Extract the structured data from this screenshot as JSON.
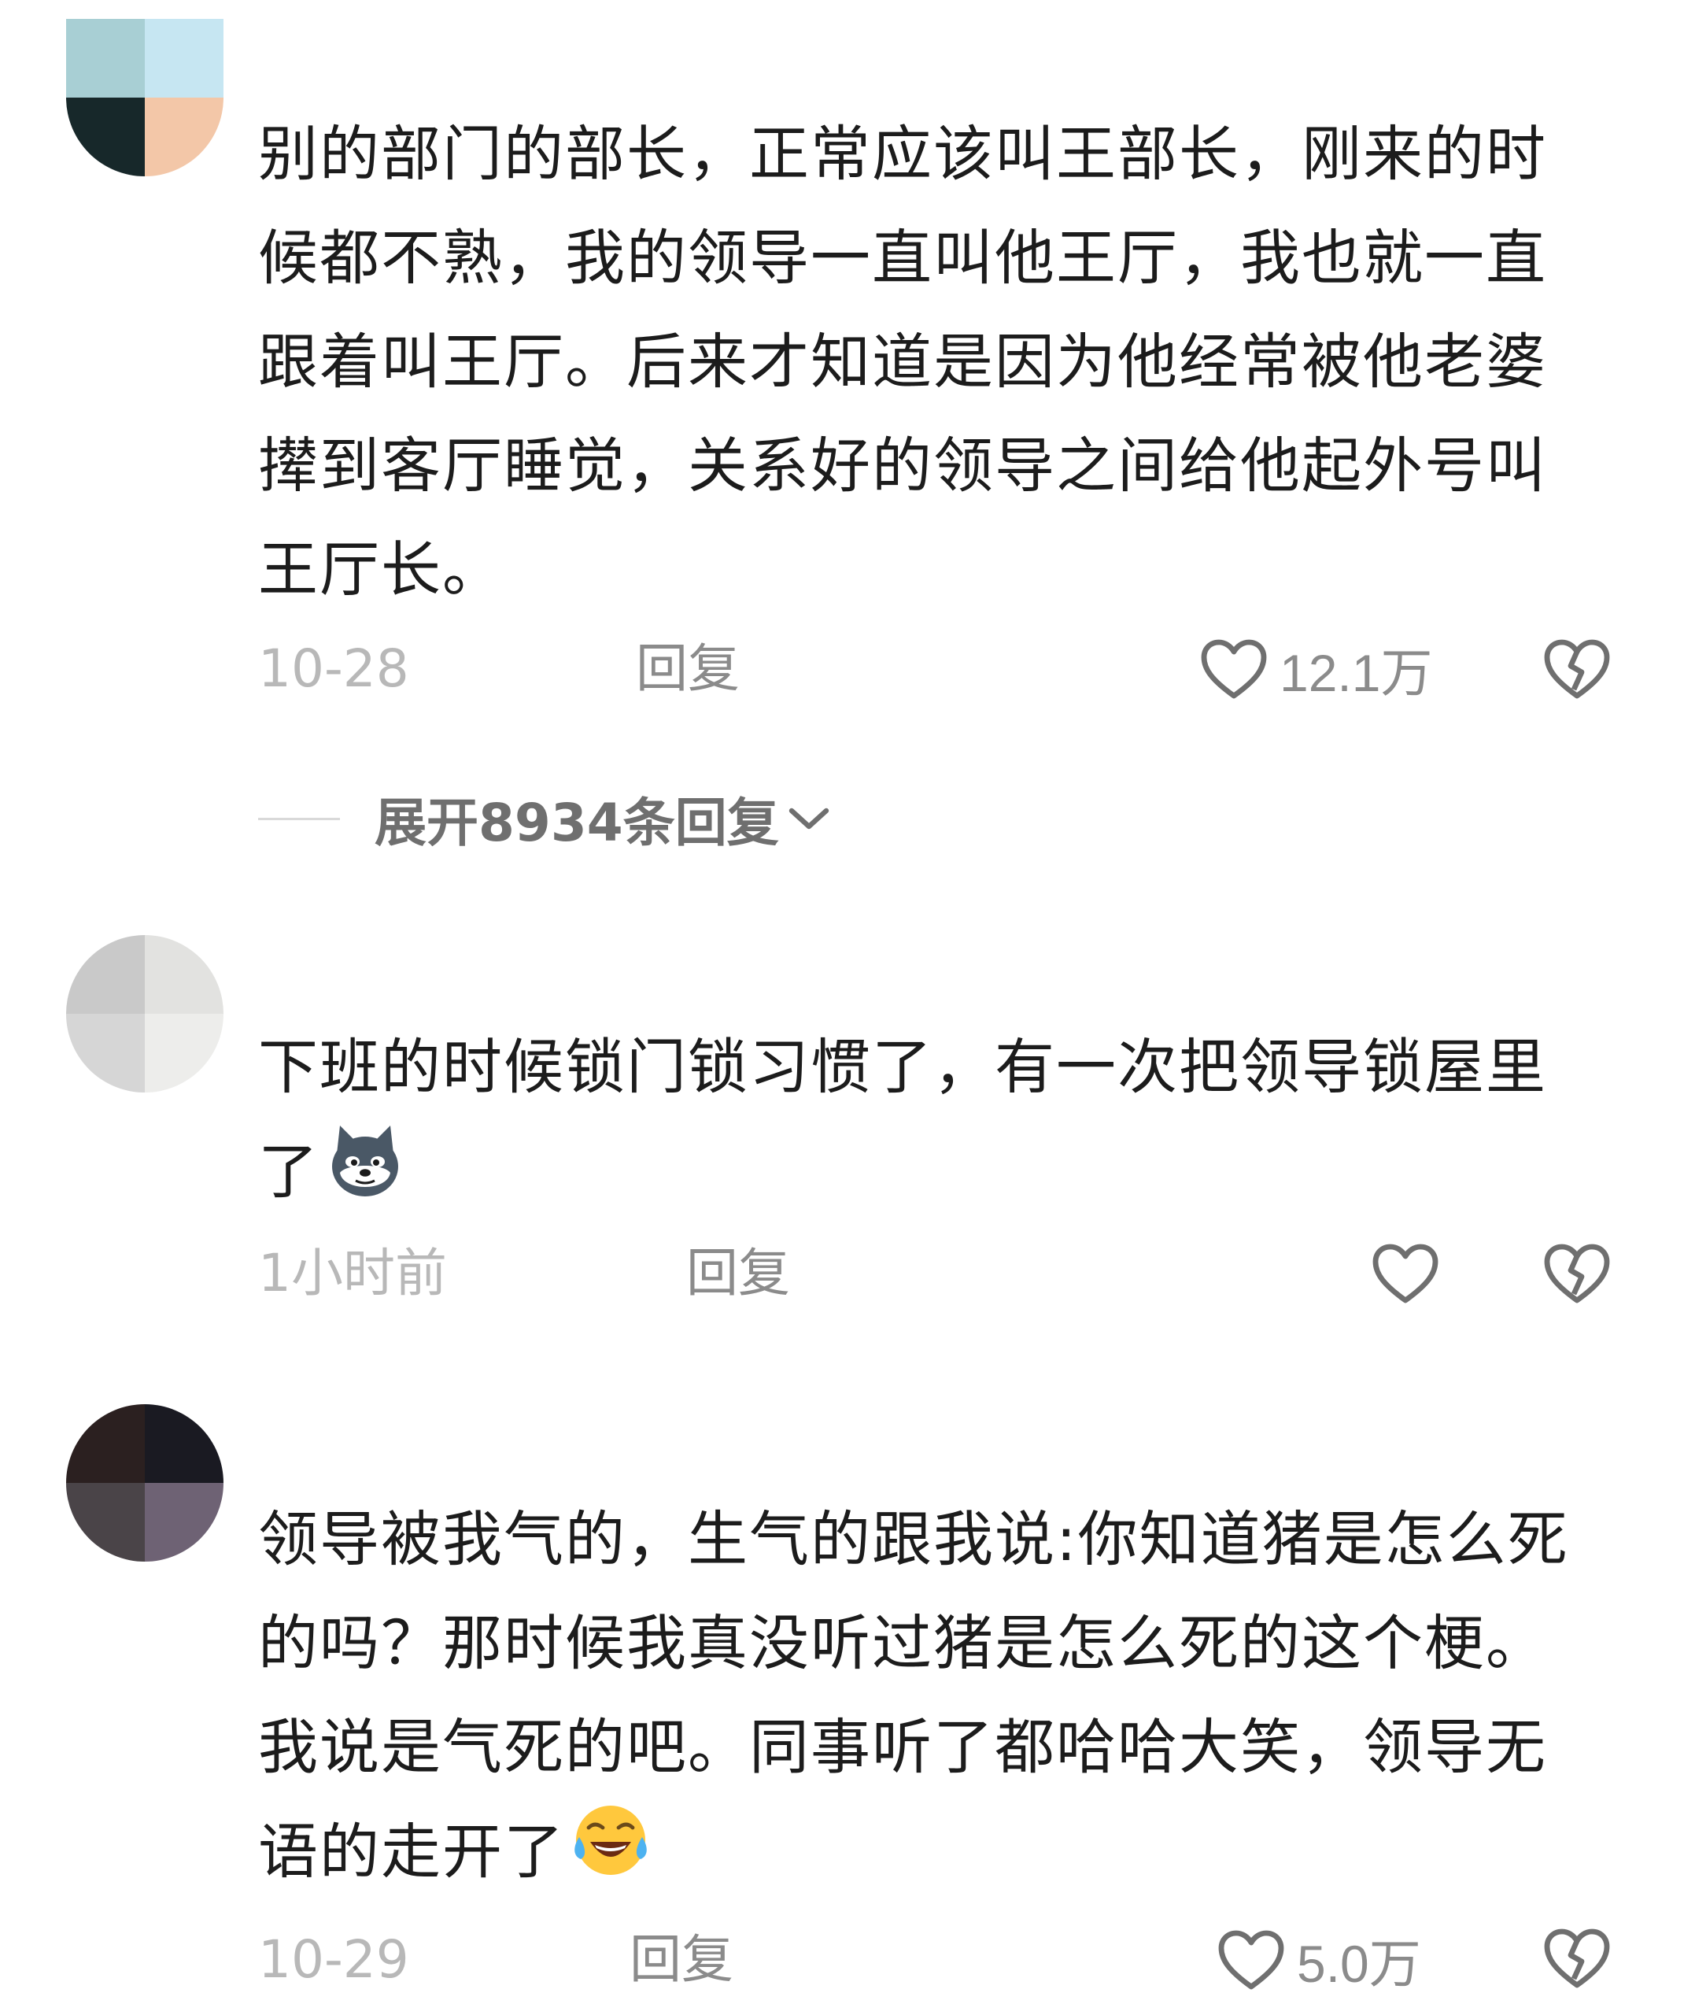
{
  "comments": [
    {
      "text": "别的部门的部长，正常应该叫王部长，刚来的时候都不熟，我的领导一直叫他王厅，我也就一直跟着叫王厅。后来才知道是因为他经常被他老婆撵到客厅睡觉，关系好的领导之间给他起外号叫王厅长。",
      "time": "10-28",
      "reply_label": "回复",
      "like_count": "12.1万",
      "expand_label": "展开8934条回复"
    },
    {
      "text": "下班的时候锁门锁习惯了，有一次把领导锁屋里了",
      "time": "1小时前",
      "reply_label": "回复",
      "like_count": ""
    },
    {
      "text": "领导被我气的，生气的跟我说:你知道猪是怎么死的吗？那时候我真没听过猪是怎么死的这个梗。我说是气死的吧。同事听了都哈哈大笑，领导无语的走开了",
      "time": "10-29",
      "reply_label": "回复",
      "like_count": "5.0万"
    }
  ],
  "colors": {
    "text": "#1c1c1c",
    "meta": "#b8b8b8",
    "action": "#8b8b8b",
    "icon_stroke": "#6f6f6f"
  },
  "icons": [
    "heart-icon",
    "broken-heart-icon",
    "chevron-down-icon",
    "husky-emoji-icon",
    "tears-of-joy-emoji-icon"
  ]
}
